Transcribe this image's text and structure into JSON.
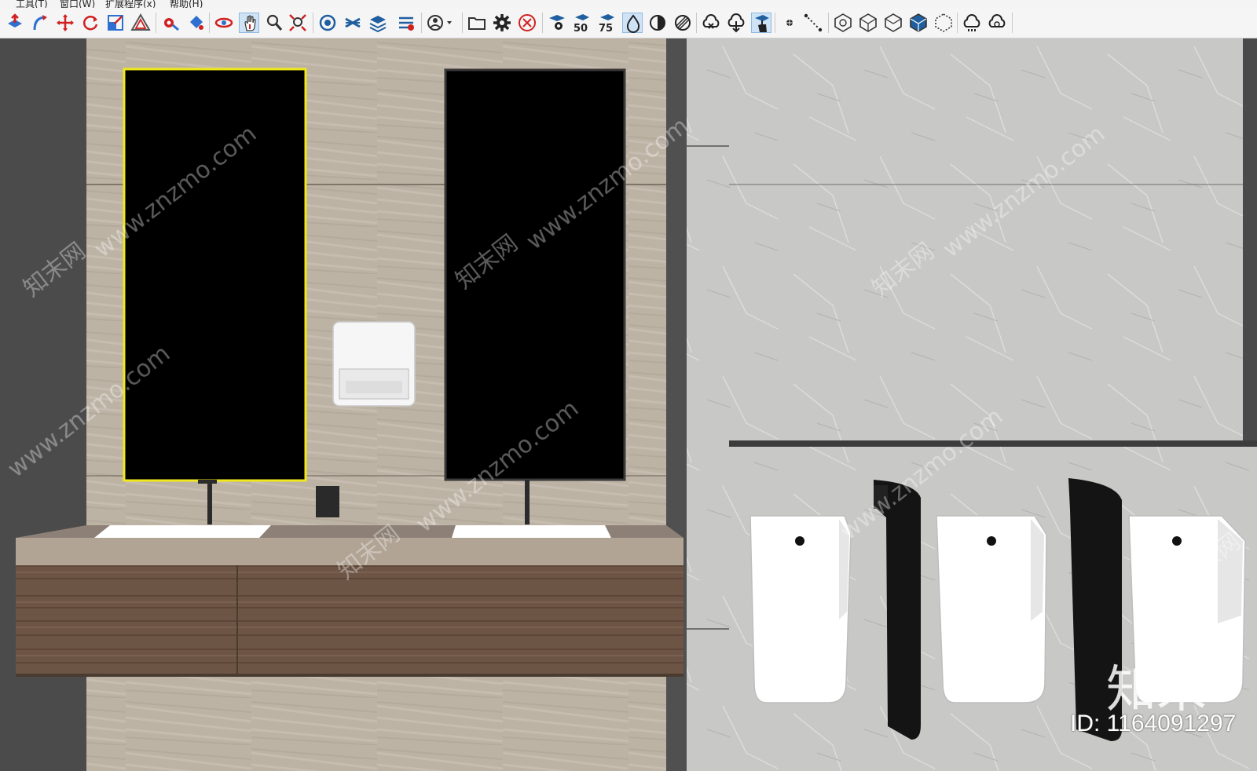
{
  "menu": {
    "items": [
      "工具(T)",
      "窗口(W)",
      "扩展程序(x)",
      "帮助(H)"
    ]
  },
  "toolbar": {
    "icons": [
      "push-pull-icon",
      "follow-me-icon",
      "move-icon",
      "rotate-icon",
      "scale-icon",
      "offset-icon",
      "tape-measure-icon",
      "paint-bucket-icon",
      "orbit-icon",
      "pan-icon",
      "zoom-icon",
      "zoom-extents-icon",
      "warehouse-icon",
      "layers-icon",
      "stack-icon",
      "share-icon",
      "account-icon",
      "open-folder-icon",
      "settings-gear-icon",
      "close-circle-icon",
      "render-eye-icon",
      "counter-50-icon",
      "counter-75-icon",
      "water-drop-icon",
      "contrast-icon",
      "stripe-icon",
      "cloud-x-icon",
      "cloud-download-icon",
      "cloud-hand-icon",
      "point-icon",
      "dotted-line-icon",
      "view-iso-icon",
      "view-top-icon",
      "view-front-icon",
      "view-right-icon",
      "view-back-icon",
      "cloud-sync-icon",
      "cloud-refresh-icon"
    ],
    "counter_50": "50",
    "counter_75": "75"
  },
  "watermark": {
    "site": "www.znzmo.com",
    "brand": "知末网",
    "logo": "知末",
    "id_label": "ID: 1164091297"
  },
  "colors": {
    "left_wall": "#bfb5a7",
    "right_wall": "#c9cac8",
    "mirror_frame_selected": "#f0e81a",
    "mirror": "#000000",
    "vanity_wood": "#6e5646",
    "countertop": "#b2a596",
    "ceramic": "#ffffff",
    "divider": "#1a1a1a",
    "dark_column": "#4a4a4a"
  }
}
